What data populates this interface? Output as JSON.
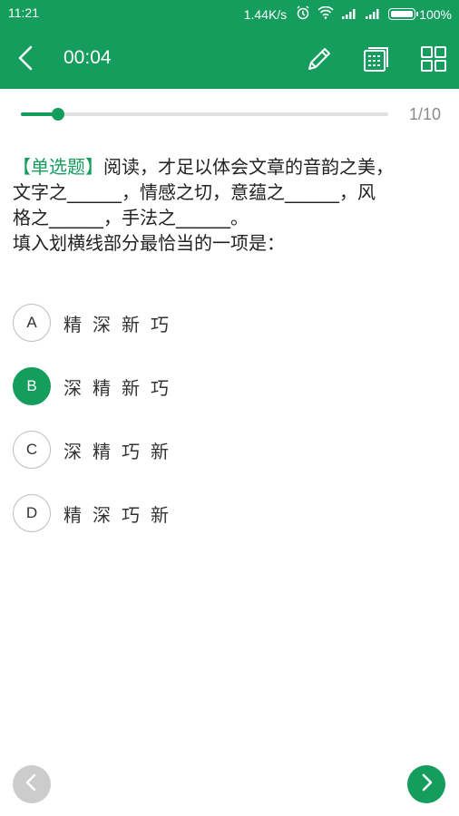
{
  "status_bar": {
    "time": "11:21",
    "speed": "1.44K/s",
    "battery": "100%"
  },
  "toolbar": {
    "timer": "00:04"
  },
  "progress": {
    "current": 1,
    "total": 10,
    "label": "1/10",
    "fraction": 0.1
  },
  "question": {
    "type_label": "【单选题】",
    "line1": "阅读，才足以体会文章的音韵之美，",
    "line2": "文字之______，情感之切，意蕴之______，风",
    "line3": "格之______，手法之______。",
    "line4": "填入划横线部分最恰当的一项是："
  },
  "options": [
    {
      "letter": "A",
      "text": "精深新巧",
      "selected": false
    },
    {
      "letter": "B",
      "text": "深精新巧",
      "selected": true
    },
    {
      "letter": "C",
      "text": "深精巧新",
      "selected": false
    },
    {
      "letter": "D",
      "text": "精深巧新",
      "selected": false
    }
  ],
  "icons": {
    "back": "chevron-left-icon",
    "edit": "pencil-icon",
    "calc": "calculator-icon",
    "grid": "grid-icon",
    "prev": "chevron-left-icon",
    "next": "chevron-right-icon"
  },
  "colors": {
    "accent": "#159d5d",
    "disabled": "#cccccc"
  }
}
